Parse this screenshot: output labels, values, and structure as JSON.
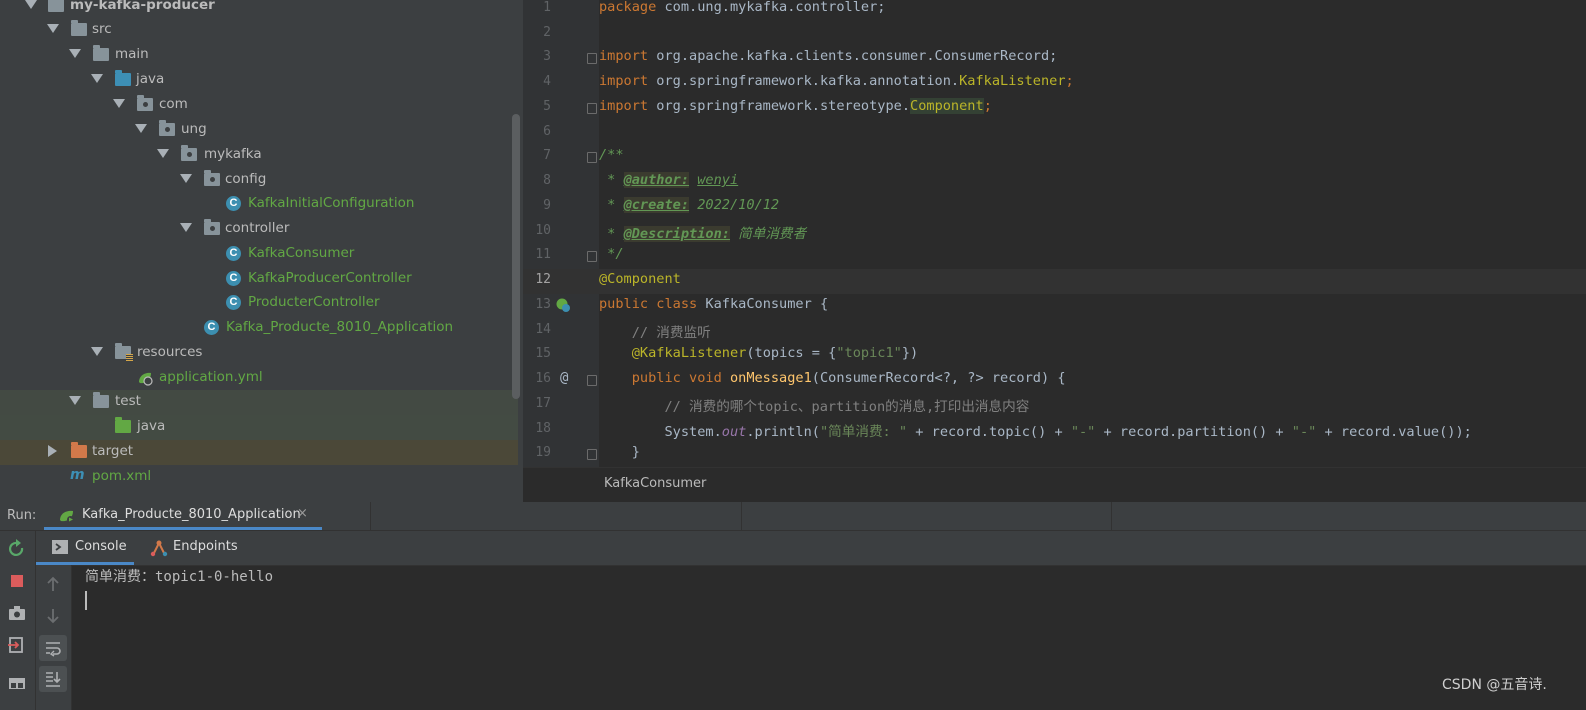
{
  "project_tree": {
    "items": [
      {
        "label": "my-kafka-producer"
      },
      {
        "label": "src"
      },
      {
        "label": "main"
      },
      {
        "label": "java"
      },
      {
        "label": "com"
      },
      {
        "label": "ung"
      },
      {
        "label": "mykafka"
      },
      {
        "label": "config"
      },
      {
        "label": "KafkaInitialConfiguration"
      },
      {
        "label": "controller"
      },
      {
        "label": "KafkaConsumer"
      },
      {
        "label": "KafkaProducerController"
      },
      {
        "label": "ProducterController"
      },
      {
        "label": "Kafka_Producte_8010_Application"
      },
      {
        "label": "resources"
      },
      {
        "label": "application.yml"
      },
      {
        "label": "test"
      },
      {
        "label": "java"
      },
      {
        "label": "target"
      },
      {
        "label": "pom.xml"
      }
    ]
  },
  "editor": {
    "line_numbers": [
      "1",
      "2",
      "3",
      "4",
      "5",
      "6",
      "7",
      "8",
      "9",
      "10",
      "11",
      "12",
      "13",
      "14",
      "15",
      "16",
      "17",
      "18",
      "19"
    ],
    "breadcrumb": "KafkaConsumer",
    "code": {
      "l1_kw": "package",
      "l1_rest": " com.ung.mykafka.controller;",
      "l3_kw": "import",
      "l3_rest": " org.apache.kafka.clients.consumer.ConsumerRecord;",
      "l4_kw": "import",
      "l4_rest": " org.springframework.kafka.annotation.",
      "l4_cls": "KafkaListener",
      "l4_end": ";",
      "l5_kw": "import",
      "l5_rest": " org.springframework.stereotype.",
      "l5_cls": "Component",
      "l5_end": ";",
      "l7": "/**",
      "l8_pre": " * ",
      "l8_tag": "@author:",
      "l8_val": "wenyi",
      "l9_pre": " * ",
      "l9_tag": "@create:",
      "l9_val": " 2022/10/12",
      "l10_pre": " * ",
      "l10_tag": "@Description:",
      "l10_val": " 简单消费者",
      "l11": " */",
      "l12": "@Component",
      "l13_kw": "public class",
      "l13_rest": " KafkaConsumer {",
      "l14": "    // 消费监听",
      "l15_ann": "    @KafkaListener",
      "l15_a": "(topics = {",
      "l15_str": "\"topic1\"",
      "l15_b": "})",
      "l16_kw": "    public void",
      "l16_fn": " onMessage1",
      "l16_rest": "(ConsumerRecord<?, ?> record) {",
      "l17": "        // 消费的哪个topic、partition的消息,打印出消息内容",
      "l18_a": "        System.",
      "l18_fld": "out",
      "l18_b": ".println(",
      "l18_s1": "\"简单消费: \"",
      "l18_c": " + record.topic() + ",
      "l18_s2": "\"-\"",
      "l18_d": " + record.partition() + ",
      "l18_s3": "\"-\"",
      "l18_e": " + record.value());",
      "l19": "    }"
    },
    "gutter_marks": {
      "l16": "@"
    }
  },
  "run_panel": {
    "label": "Run:",
    "tab_title": "Kafka_Producte_8010_Application",
    "tab_close": "×",
    "subtabs": {
      "console": "Console",
      "endpoints": "Endpoints"
    },
    "console_output": "简单消费：topic1-0-hello",
    "icons": [
      "rerun-icon",
      "stop-icon",
      "camera-icon",
      "exit-icon",
      "layout-icon",
      "up-arrow-icon",
      "down-arrow-icon",
      "soft-wrap-icon",
      "scroll-to-end-icon"
    ]
  },
  "watermark": "CSDN @五音诗.",
  "colors": {
    "keyword": "#cc7832",
    "annotation": "#bbb529",
    "string": "#6a8759",
    "doc_comment": "#629755",
    "function": "#ffc66d",
    "accent": "#4a88c7"
  }
}
